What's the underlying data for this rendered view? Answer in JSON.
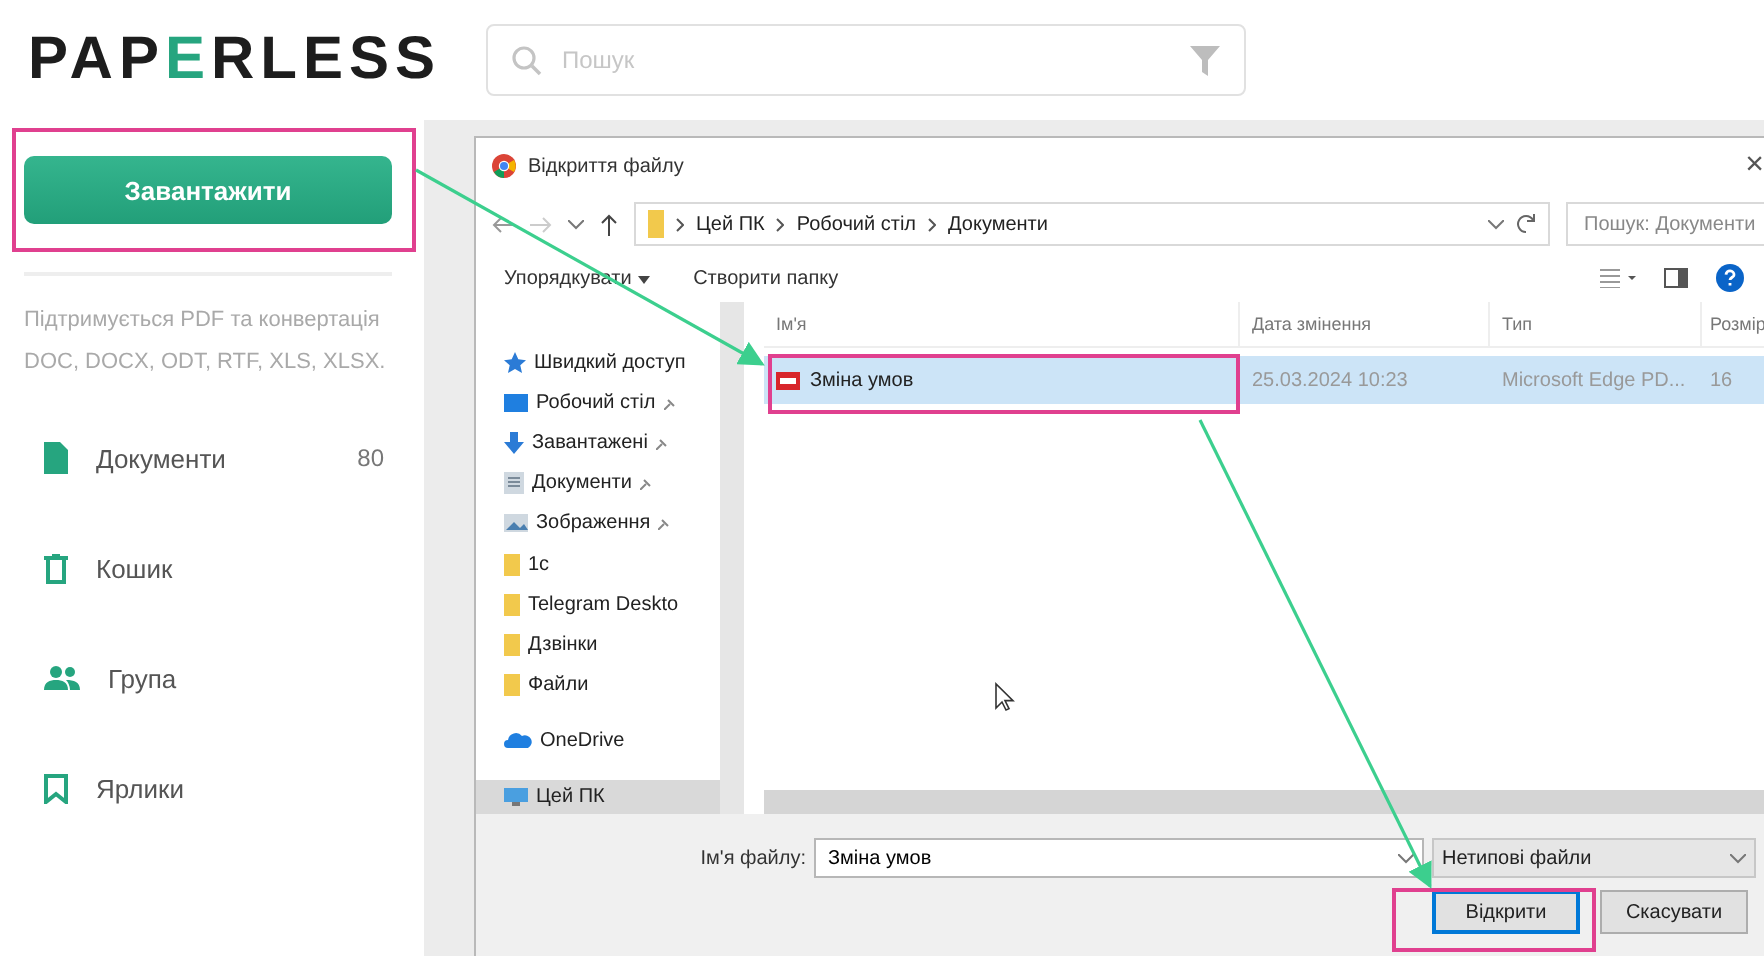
{
  "app": {
    "logo": "PAPERLESS",
    "search": {
      "placeholder": "Пошук"
    }
  },
  "sidebar": {
    "upload_button": "Завантажити",
    "hint": "Підтримується PDF та конвертація DOC, DOCX, ODT, RTF, XLS, XLSX.",
    "items": [
      {
        "kind": "document",
        "label": "Документи",
        "count": "80"
      },
      {
        "kind": "trash",
        "label": "Кошик"
      },
      {
        "kind": "group",
        "label": "Група"
      },
      {
        "kind": "bookmark",
        "label": "Ярлики"
      }
    ]
  },
  "dialog": {
    "title": "Відкриття файлу",
    "close": "×",
    "breadcrumbs": [
      "Цей ПК",
      "Робочий стіл",
      "Документи"
    ],
    "search": {
      "placeholder": "Пошук: Документи"
    },
    "toolbar": {
      "organize": "Упорядкувати",
      "new_folder": "Створити папку"
    },
    "nav": [
      {
        "kind": "star",
        "label": "Швидкий доступ",
        "selected": false
      },
      {
        "kind": "desktop",
        "label": "Робочий стіл",
        "selected": false
      },
      {
        "kind": "download",
        "label": "Завантажені",
        "selected": false
      },
      {
        "kind": "docs",
        "label": "Документи",
        "selected": false
      },
      {
        "kind": "pictures",
        "label": "Зображення",
        "selected": false
      },
      {
        "kind": "folder",
        "label": "1с",
        "selected": false
      },
      {
        "kind": "folder",
        "label": "Telegram Deskto",
        "selected": false
      },
      {
        "kind": "folder",
        "label": "Дзвінки",
        "selected": false
      },
      {
        "kind": "folder",
        "label": "Файли",
        "selected": false
      },
      {
        "kind": "cloud",
        "label": "OneDrive",
        "selected": false
      },
      {
        "kind": "pc",
        "label": "Цей ПК",
        "selected": true
      }
    ],
    "columns": [
      "Ім'я",
      "Дата змінення",
      "Тип",
      "Розмір"
    ],
    "files": [
      {
        "name": "Зміна умов",
        "date": "25.03.2024 10:23",
        "type": "Microsoft Edge PD...",
        "size": "16",
        "selected": true
      }
    ],
    "filename_label": "Ім'я файлу:",
    "filename": "Зміна умов",
    "filetype": "Нетипові файли",
    "buttons": [
      {
        "label": "Відкрити",
        "kind": "primary"
      },
      {
        "label": "Скасувати",
        "kind": "secondary"
      }
    ]
  }
}
